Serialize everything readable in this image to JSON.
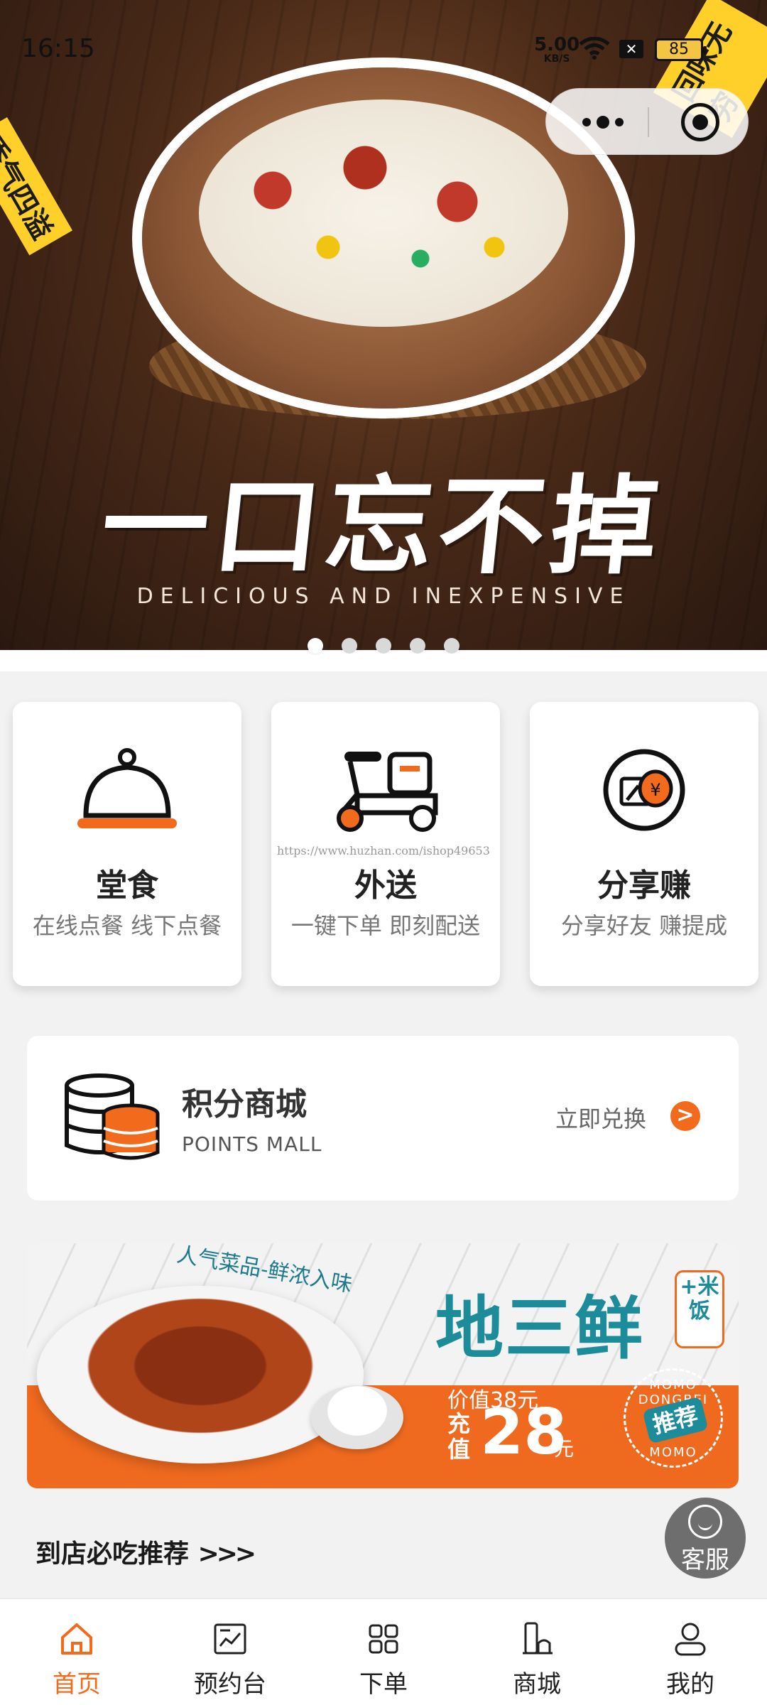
{
  "status_bar": {
    "time": "16:15",
    "net_speed": "5.00",
    "net_unit": "KB/S",
    "battery": "85"
  },
  "hero": {
    "slogan": "一口忘不掉",
    "tagline": "DELICIOUS AND INEXPENSIVE",
    "badge_left": "香气四溢",
    "badge_right": "回味无穷",
    "carousel_count": 5,
    "carousel_active": 0
  },
  "services": [
    {
      "title": "堂食",
      "subtitle": "在线点餐  线下点餐",
      "icon": "cloche-icon"
    },
    {
      "title": "外送",
      "subtitle": "一键下单  即刻配送",
      "icon": "scooter-icon"
    },
    {
      "title": "分享赚",
      "subtitle": "分享好友  赚提成",
      "icon": "share-money-icon"
    }
  ],
  "watermark": "https://www.huzhan.com/ishop49653",
  "points_mall": {
    "title": "积分商城",
    "subtitle": "POINTS MALL",
    "action": "立即兑换",
    "arrow": ">"
  },
  "promo": {
    "kicker": "人气菜品-鲜浓入味",
    "dish": "地三鲜",
    "addon": "+米饭",
    "original_price": "价值38元",
    "recharge_label": "充值",
    "price": "28",
    "price_unit": "元",
    "stamp_top": "MOMO DONGBEI",
    "stamp_center": "推荐",
    "stamp_bottom": "MOMO"
  },
  "section_title": "到店必吃推荐",
  "section_arrows": ">>>",
  "customer_service": "客服",
  "tabs": [
    {
      "label": "首页",
      "icon": "home-icon",
      "active": true
    },
    {
      "label": "预约台",
      "icon": "reservation-icon",
      "active": false
    },
    {
      "label": "下单",
      "icon": "grid-icon",
      "active": false
    },
    {
      "label": "商城",
      "icon": "shop-icon",
      "active": false
    },
    {
      "label": "我的",
      "icon": "user-icon",
      "active": false
    }
  ],
  "colors": {
    "accent": "#f26a1b",
    "teal": "#1c8c9a",
    "background": "#f2f2f2"
  }
}
